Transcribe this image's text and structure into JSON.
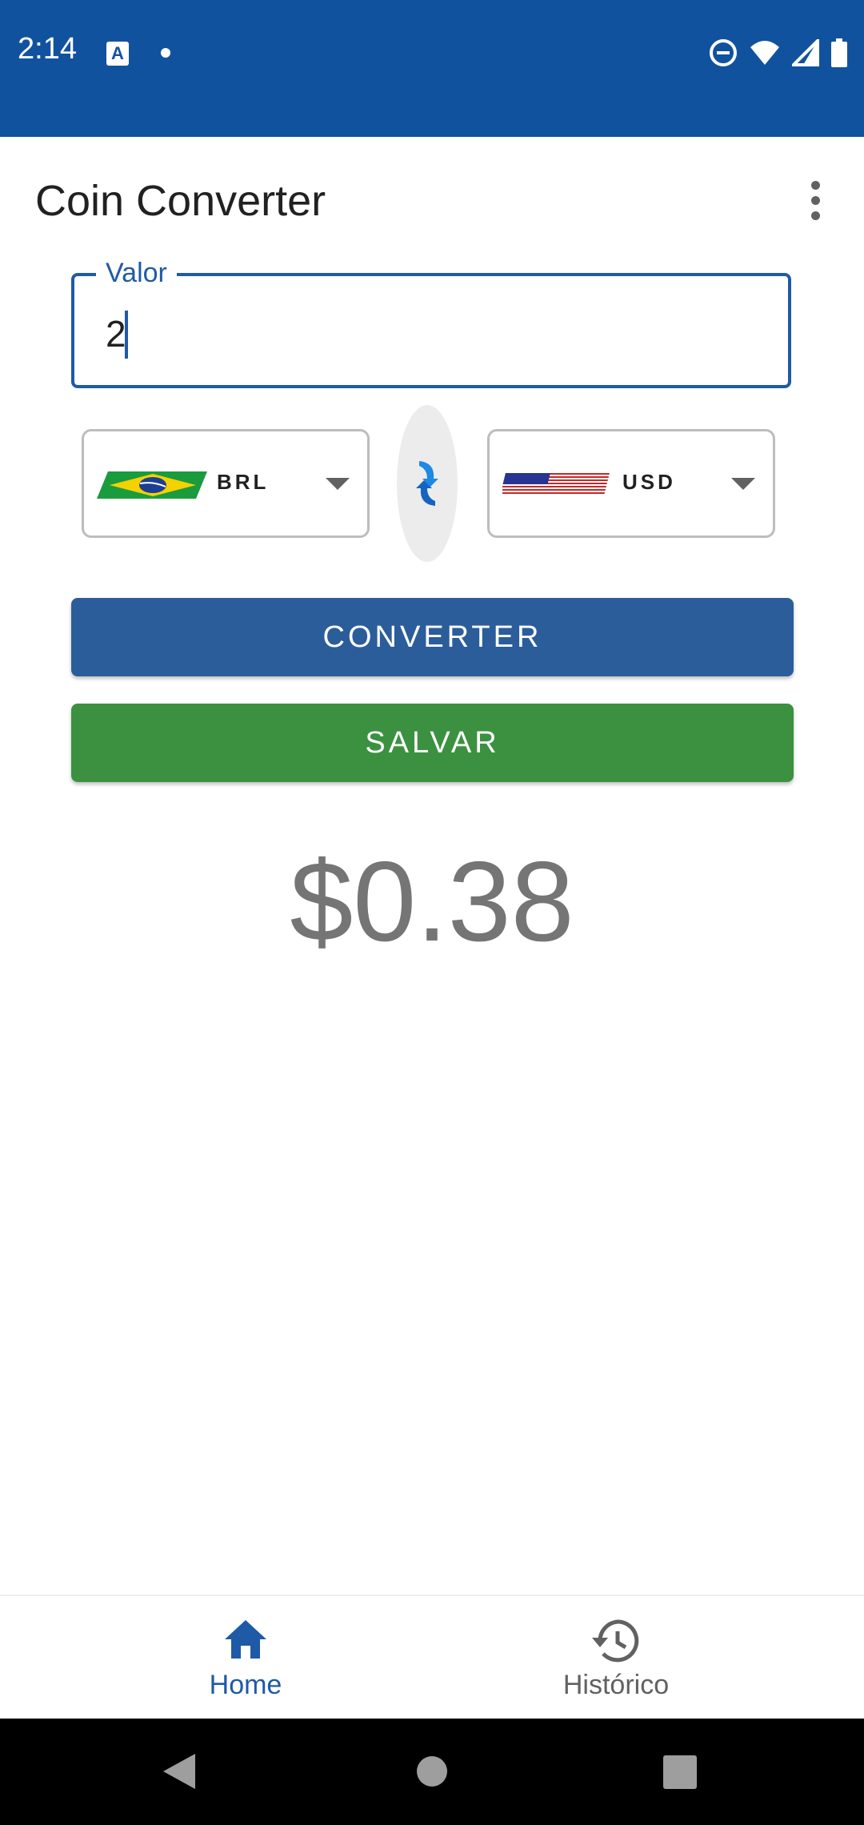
{
  "status_bar": {
    "time": "2:14",
    "notification_icon": "A",
    "icons": [
      "dnd-icon",
      "wifi-icon",
      "signal-icon",
      "battery-icon"
    ]
  },
  "app_bar": {
    "title": "Coin Converter",
    "menu_icon": "more-vert-icon"
  },
  "value_field": {
    "label": "Valor",
    "value": "2"
  },
  "from_currency": {
    "code": "BRL",
    "flag": "brazil-flag-icon"
  },
  "to_currency": {
    "code": "USD",
    "flag": "usa-flag-icon"
  },
  "swap_icon": "swap-arrows-icon",
  "buttons": {
    "convert": "CONVERTER",
    "save": "SALVAR"
  },
  "result": "$0.38",
  "bottom_nav": {
    "items": [
      {
        "label": "Home",
        "icon": "home-icon",
        "selected": true
      },
      {
        "label": "Histórico",
        "icon": "history-icon",
        "selected": false
      }
    ]
  },
  "colors": {
    "primary": "#11529e",
    "convert_button": "#2c5d9b",
    "save_button": "#3b9140",
    "selected_nav": "#1f5aa6",
    "unselected_nav": "#616161"
  }
}
